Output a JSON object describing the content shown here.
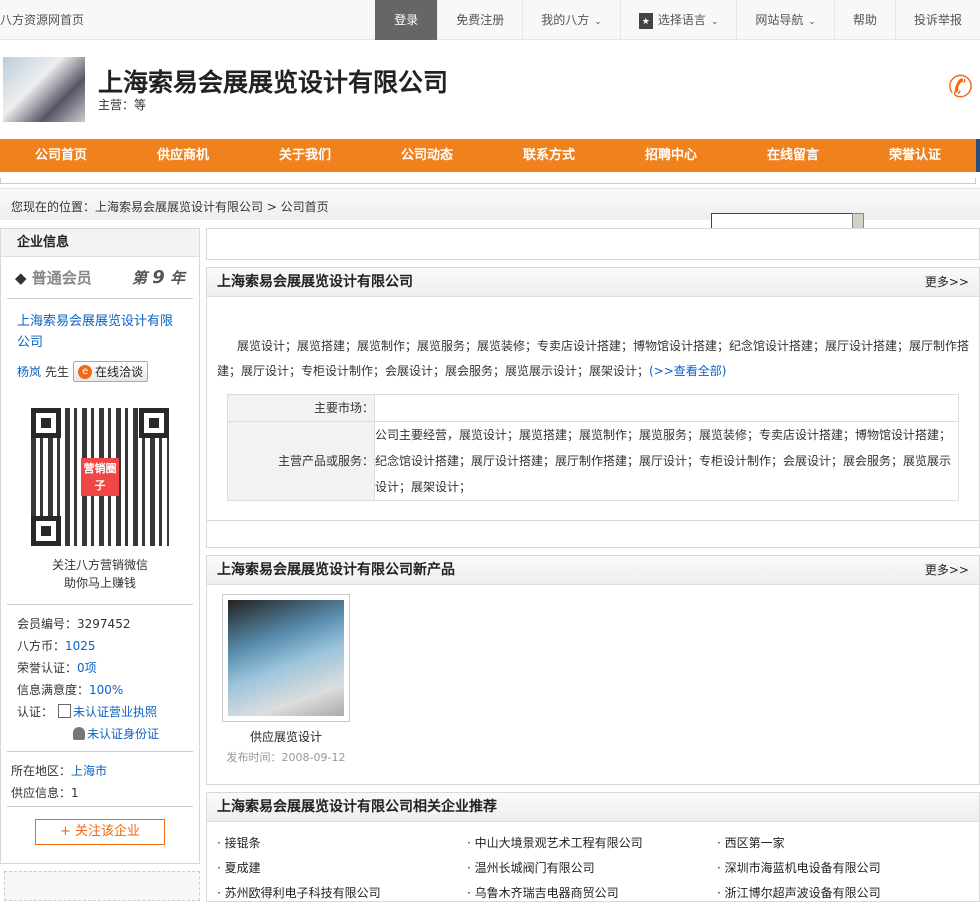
{
  "topbar": {
    "home": "八方资源网首页",
    "items": [
      {
        "label": "登录"
      },
      {
        "label": "免费注册"
      },
      {
        "label": "我的八方"
      },
      {
        "label": "选择语言"
      },
      {
        "label": "网站导航"
      },
      {
        "label": "帮助"
      },
      {
        "label": "投诉举报"
      }
    ]
  },
  "header": {
    "company_name": "上海索易会展展览设计有限公司",
    "subtitle": "主营：等"
  },
  "nav": [
    "公司首页",
    "供应商机",
    "关于我们",
    "公司动态",
    "联系方式",
    "招聘中心",
    "在线留言",
    "荣誉认证"
  ],
  "breadcrumb": "您现在的位置：上海索易会展展览设计有限公司 > 公司首页",
  "left": {
    "title": "企业信息",
    "member_level": "普通会员",
    "year_prefix": "第",
    "years": "9",
    "year_suffix": "年",
    "company_link": "上海索易会展展览设计有限公司",
    "contact_name": "杨岚",
    "contact_title": "先生",
    "chat_label": "在线洽谈",
    "qr_center": "营销圈子",
    "qr_text1": "关注八方营销微信",
    "qr_text2": "助你马上赚钱",
    "stats": {
      "member_no_label": "会员编号：",
      "member_no": "3297452",
      "coins_label": "八方币：",
      "coins": "1025",
      "honor_label": "荣誉认证：",
      "honor": "0项",
      "satisfaction_label": "信息满意度：",
      "satisfaction": "100%",
      "cert_label": "认证：",
      "license": "未认证营业执照",
      "identity": "未认证身份证"
    },
    "region_label": "所在地区：",
    "region": "上海市",
    "supply_label": "供应信息：",
    "supply": "1",
    "follow_label": "+ 关注该企业"
  },
  "intro": {
    "title": "上海索易会展展览设计有限公司",
    "more": "更多>>",
    "text": "展览设计；展览搭建；展览制作；展览服务；展览装修；专卖店设计搭建；博物馆设计搭建；纪念馆设计搭建；展厅设计搭建；展厅制作搭建；展厅设计；专柜设计制作；会展设计；展会服务；展览展示设计；展架设计；",
    "view_all": "(>>查看全部)",
    "table": [
      {
        "key": "主要市场：",
        "value": ""
      },
      {
        "key": "主营产品或服务：",
        "value": "公司主要经营，展览设计；展览搭建；展览制作；展览服务；展览装修；专卖店设计搭建；博物馆设计搭建；纪念馆设计搭建；展厅设计搭建；展厅制作搭建；展厅设计；专柜设计制作；会展设计；展会服务；展览展示设计；展架设计；"
      }
    ]
  },
  "products": {
    "title": "上海索易会展展览设计有限公司新产品",
    "more": "更多>>",
    "items": [
      {
        "name": "供应展览设计",
        "date_label": "发布时间：",
        "date": "2008-09-12"
      }
    ]
  },
  "related": {
    "title": "上海索易会展展览设计有限公司相关企业推荐",
    "items": [
      "接锟条",
      "中山大境景观艺术工程有限公司",
      "西区第一家",
      "夏成建",
      "温州长城阀门有限公司",
      "深圳市海蓝机电设备有限公司",
      "苏州欧得利电子科技有限公司",
      "乌鲁木齐瑞吉电器商贸公司",
      "浙江博尔超声波设备有限公司"
    ]
  }
}
